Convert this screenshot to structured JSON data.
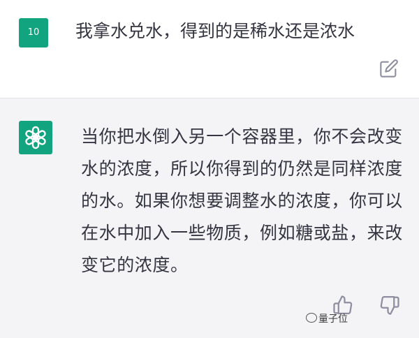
{
  "user_message": {
    "avatar_label": "10",
    "text": "我拿水兑水，得到的是稀水还是浓水"
  },
  "assistant_message": {
    "text": "当你把水倒入另一个容器里，你不会改变水的浓度，所以你得到的仍然是同样浓度的水。如果你想要调整水的浓度，你可以在水中加入一些物质，例如糖或盐，来改变它的浓度。"
  },
  "watermark": {
    "text": "量子位"
  },
  "colors": {
    "accent": "#12a37f",
    "assistant_background": "#f4f4f6",
    "text": "#343541",
    "icon": "#8e8ea0"
  },
  "icons": {
    "edit": "edit-icon",
    "openai": "openai-logo-icon",
    "thumbs_up": "thumbs-up-icon",
    "thumbs_down": "thumbs-down-icon",
    "watermark": "wechat-icon"
  }
}
